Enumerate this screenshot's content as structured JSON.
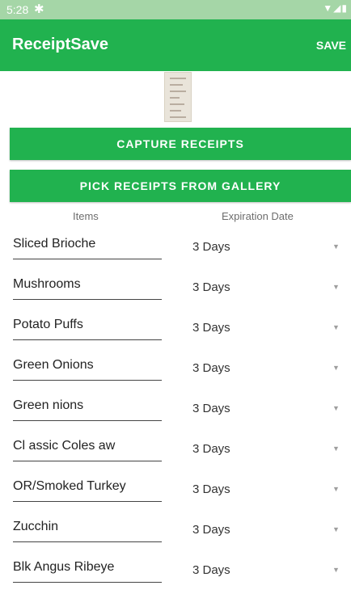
{
  "status_bar": {
    "time": "5:28",
    "settings_icon": "gear-icon",
    "signal_icons": "wifi-signal-battery"
  },
  "app_bar": {
    "title": "ReceiptSave",
    "save_label": "SAVE"
  },
  "buttons": {
    "capture": "CAPTURE RECEIPTS",
    "pick": "PICK RECEIPTS FROM GALLERY"
  },
  "list": {
    "headers": {
      "items": "Items",
      "expiration": "Expiration Date"
    },
    "rows": [
      {
        "item": "Sliced Brioche",
        "expiration": "3 Days"
      },
      {
        "item": "Mushrooms",
        "expiration": "3 Days"
      },
      {
        "item": "Potato Puffs",
        "expiration": "3 Days"
      },
      {
        "item": "Green Onions",
        "expiration": "3 Days"
      },
      {
        "item": "Green nions",
        "expiration": "3 Days"
      },
      {
        "item": "Cl assic Coles aw",
        "expiration": "3 Days"
      },
      {
        "item": "OR/Smoked Turkey",
        "expiration": "3 Days"
      },
      {
        "item": "Zucchin",
        "expiration": "3 Days"
      },
      {
        "item": "Blk Angus Ribeye",
        "expiration": "3 Days"
      }
    ]
  },
  "colors": {
    "primary": "#21b24f",
    "status_bar": "#a5d6a7"
  }
}
